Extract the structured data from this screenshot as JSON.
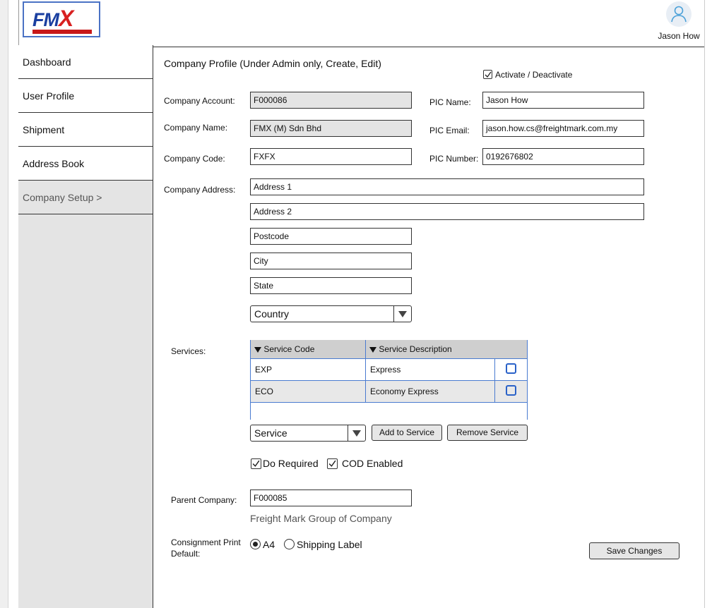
{
  "header": {
    "logo_text": "FMX",
    "user_name": "Jason How"
  },
  "sidebar": {
    "items": [
      {
        "label": "Dashboard"
      },
      {
        "label": "User Profile"
      },
      {
        "label": "Shipment"
      },
      {
        "label": "Address Book"
      },
      {
        "label": "Company Setup >"
      }
    ]
  },
  "form": {
    "title": "Company Profile (Under Admin only, Create, Edit)",
    "activate_label": "Activate / Deactivate",
    "activate_checked": true,
    "company_account_label": "Company Account:",
    "company_account_value": "F000086",
    "company_name_label": "Company Name:",
    "company_name_value": "FMX (M) Sdn Bhd",
    "company_code_label": "Company Code:",
    "company_code_value": "FXFX",
    "pic_name_label": "PIC Name:",
    "pic_name_value": "Jason How",
    "pic_email_label": "PIC Email:",
    "pic_email_value": "jason.how.cs@freightmark.com.my",
    "pic_number_label": "PIC Number:",
    "pic_number_value": "0192676802",
    "company_address_label": "Company Address:",
    "address1": "Address 1",
    "address2": "Address 2",
    "postcode": "Postcode",
    "city": "City",
    "state": "State",
    "country": "Country"
  },
  "services": {
    "label": "Services:",
    "columns": [
      "Service Code",
      "Service Description"
    ],
    "rows": [
      {
        "code": "EXP",
        "description": "Express",
        "checked": false
      },
      {
        "code": "ECO",
        "description": "Economy Express",
        "checked": false
      }
    ],
    "service_select": "Service",
    "add_button": "Add to Service",
    "remove_button": "Remove Service"
  },
  "options": {
    "do_required_label": "Do Required",
    "do_required_checked": true,
    "cod_enabled_label": "COD Enabled",
    "cod_enabled_checked": true
  },
  "parent": {
    "label": "Parent Company:",
    "value": "F000085",
    "description": "Freight Mark Group of Company"
  },
  "consignment": {
    "label_line1": "Consignment Print",
    "label_line2": "Default:",
    "option_a4": "A4",
    "option_shipping": "Shipping Label",
    "selected": "A4"
  },
  "save_button": "Save Changes",
  "colors": {
    "accent_blue": "#4a7bd0",
    "logo_blue": "#1a3fa0",
    "logo_red": "#d82020",
    "readonly_bg": "#e4e4e4"
  }
}
